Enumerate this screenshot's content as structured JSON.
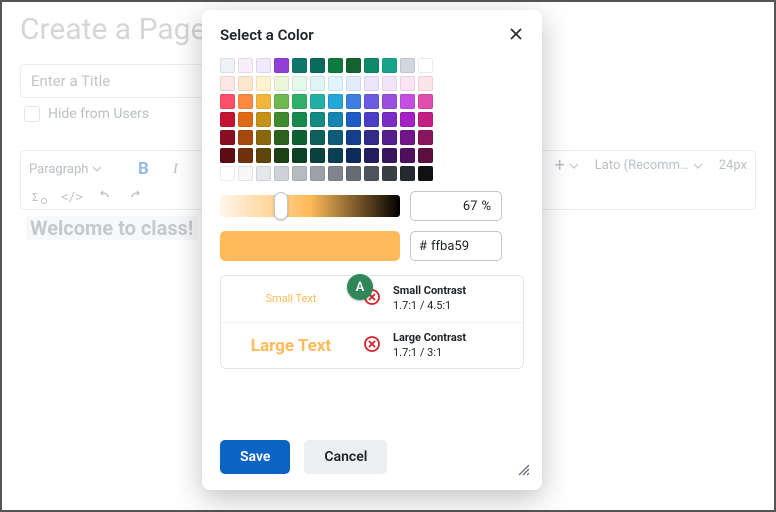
{
  "page": {
    "title": "Create a Page",
    "title_placeholder": "Enter a Title",
    "hide_label": "Hide from Users",
    "content_text": "Welcome to class!"
  },
  "toolbar": {
    "paragraph_label": "Paragraph",
    "font_label": "Lato (Recomm…",
    "size_label": "24px"
  },
  "modal": {
    "title": "Select a Color",
    "selected_hex": "ffba59",
    "opacity_value": "67",
    "opacity_unit": "%",
    "hex_prefix": "#",
    "save_label": "Save",
    "cancel_label": "Cancel",
    "preview_color": "#ffba59",
    "annotation_badge": "A",
    "small_sample": "Small Text",
    "large_sample": "Large Text",
    "small_contrast_title": "Small Contrast",
    "small_contrast_value": "1.7:1 / 4.5:1",
    "large_contrast_title": "Large Contrast",
    "large_contrast_value": "1.7:1 / 3:1",
    "swatch_rows": [
      [
        "#eef2f7",
        "#f7eef7",
        "#f0e8fb",
        "#9140d6",
        "#0f766e",
        "#0a6b5d",
        "#0e7a3c",
        "#14632f",
        "#0e8a6a",
        "#17a38b",
        "#d0d7de",
        "#ffffff"
      ],
      [
        "#ffe7e3",
        "#ffe8cf",
        "#fff3cf",
        "#ecf7da",
        "#e6f7ec",
        "#dff4f4",
        "#dff4fb",
        "#e3ecfb",
        "#ece4fb",
        "#f3e4fb",
        "#fbe4f3",
        "#fbe4ea"
      ],
      [
        "#ff4f6b",
        "#ff8a3d",
        "#f2b63d",
        "#6db84f",
        "#2fb06a",
        "#22b0a6",
        "#22a8d8",
        "#3d7fe0",
        "#6a5be0",
        "#9a4fe0",
        "#c44fe0",
        "#e04fab"
      ],
      [
        "#c41431",
        "#e06a14",
        "#c49214",
        "#3f8a2c",
        "#168a4a",
        "#148a82",
        "#1484b0",
        "#1f5bc4",
        "#4a3ec4",
        "#7a2cc4",
        "#a41fc4",
        "#c41f84"
      ],
      [
        "#8a0e22",
        "#a6490e",
        "#8a660e",
        "#2c611e",
        "#0e6134",
        "#0e615b",
        "#0e5c7a",
        "#153f8a",
        "#332b8a",
        "#561e8a",
        "#73158a",
        "#8a155c"
      ],
      [
        "#5e0a17",
        "#70310a",
        "#5e450a",
        "#1d4214",
        "#0a4223",
        "#0a423e",
        "#0a3f54",
        "#0e2b5e",
        "#231d5e",
        "#3b145e",
        "#4f0e5e",
        "#5e0e3f"
      ],
      [
        "#ffffff",
        "#f7f7f7",
        "#e5e7ea",
        "#cfd3d8",
        "#b6bbc2",
        "#9ba1aa",
        "#7f858f",
        "#666c75",
        "#4e545c",
        "#3a3f46",
        "#26292e",
        "#0f1113"
      ]
    ]
  }
}
